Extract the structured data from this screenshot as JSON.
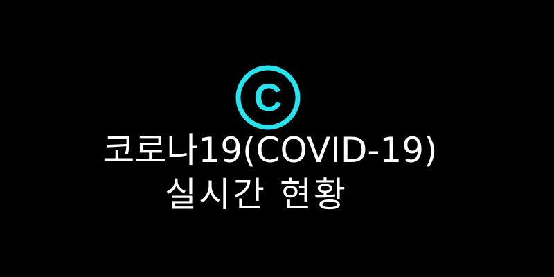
{
  "logo": {
    "letter": "C",
    "icon": "circle-c-logo-icon",
    "color": "#27e3ee"
  },
  "title": {
    "line1": "코로나19(COVID-19)",
    "line2": "실시간 현황"
  },
  "colors": {
    "background": "#000000",
    "text": "#ffffff",
    "accent": "#27e3ee"
  }
}
